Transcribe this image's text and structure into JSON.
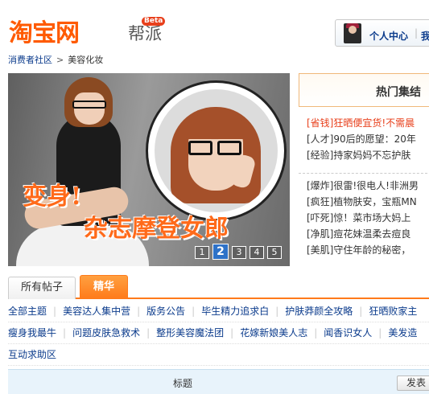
{
  "header": {
    "logo_main": "淘宝网",
    "logo_sub": "帮派",
    "logo_badge": "Beta",
    "user_center": "个人中心",
    "user_center_2": "我"
  },
  "breadcrumb": {
    "items": [
      "消费者社区",
      "美容化妆"
    ],
    "separator": ">"
  },
  "banner": {
    "line1": "变身!",
    "line2": "杂志摩登女郎",
    "pages": [
      "1",
      "2",
      "3",
      "4",
      "5"
    ],
    "active_page": "2"
  },
  "hot": {
    "title": "热门集结",
    "group1": [
      {
        "tag": "[省钱]",
        "text": "狂晒便宜货!不需晨"
      },
      {
        "tag": "[人才]",
        "text": "90后的愿望：20年"
      },
      {
        "tag": "[经验]",
        "text": "持家妈妈不忘护肤"
      }
    ],
    "group2": [
      {
        "tag": "[爆炸]",
        "text": "很雷!很电人!非洲男"
      },
      {
        "tag": "[疯狂]",
        "text": "植物肤安，宝瓶MN"
      },
      {
        "tag": "[吓死]",
        "text": "惊！菜市场大妈上"
      },
      {
        "tag": "[净肌]",
        "text": "痘花妹温柔去痘良"
      },
      {
        "tag": "[美肌]",
        "text": "守住年龄的秘密，"
      }
    ]
  },
  "tabs": {
    "all": "所有帖子",
    "essence": "精华"
  },
  "categories": {
    "row1": [
      "全部主题",
      "美容达人集中营",
      "版务公告",
      "毕生精力追求白",
      "护肤莽颜全攻略",
      "狂晒败家主"
    ],
    "row2": [
      "瘦身我最牛",
      "问题皮肤急救术",
      "整形美容魔法团",
      "花嫁新娘美人志",
      "闻香识女人",
      "美发造"
    ],
    "row3": [
      "互动求助区"
    ]
  },
  "table": {
    "title_col": "标题",
    "post_button": "发表"
  },
  "colors": {
    "brand_orange": "#ff5a00",
    "link_blue": "#0b3b8c",
    "tab_orange": "#ff7a1a",
    "hot_red": "#e8401c"
  }
}
